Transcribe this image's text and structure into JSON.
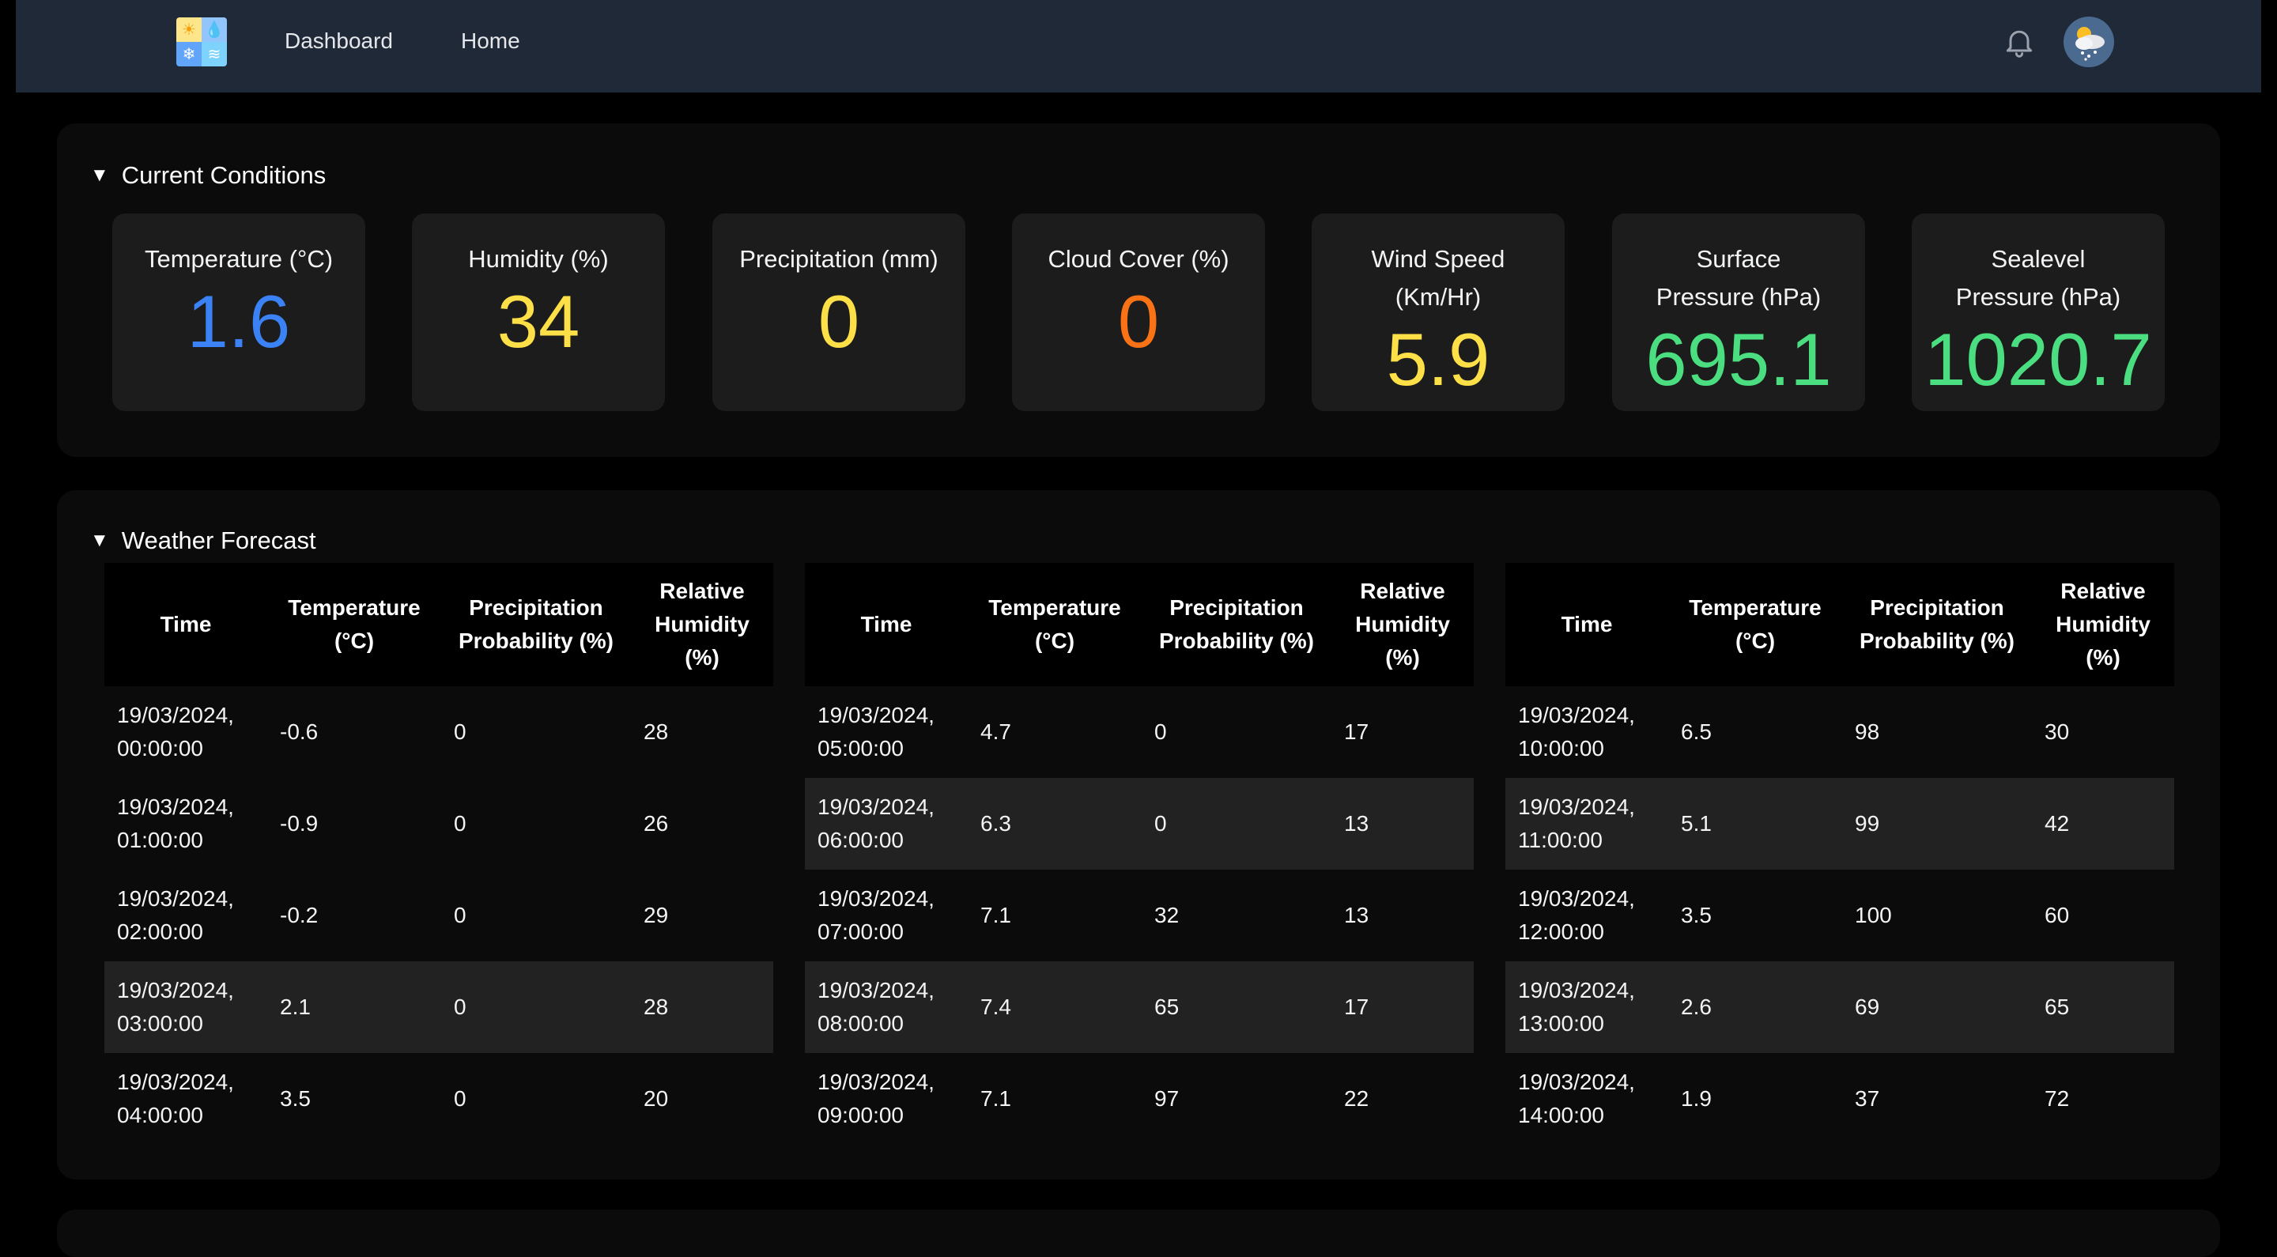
{
  "nav": {
    "links": [
      "Dashboard",
      "Home"
    ]
  },
  "current": {
    "title": "Current Conditions",
    "cards": [
      {
        "label": "Temperature (°C)",
        "value": "1.6",
        "color": "#3b82f6"
      },
      {
        "label": "Humidity (%)",
        "value": "34",
        "color": "#fde047"
      },
      {
        "label": "Precipitation (mm)",
        "value": "0",
        "color": "#fde047"
      },
      {
        "label": "Cloud Cover (%)",
        "value": "0",
        "color": "#f97316"
      },
      {
        "label": "Wind Speed (Km/Hr)",
        "value": "5.9",
        "color": "#fde047"
      },
      {
        "label": "Surface Pressure (hPa)",
        "value": "695.1",
        "color": "#4ade80"
      },
      {
        "label": "Sealevel Pressure (hPa)",
        "value": "1020.7",
        "color": "#4ade80"
      }
    ]
  },
  "forecast": {
    "title": "Weather Forecast",
    "headers": [
      "Time",
      "Temperature (°C)",
      "Precipitation Probability (%)",
      "Relative Humidity (%)"
    ],
    "tables": [
      [
        [
          "19/03/2024, 00:00:00",
          "-0.6",
          "0",
          "28"
        ],
        [
          "19/03/2024, 01:00:00",
          "-0.9",
          "0",
          "26"
        ],
        [
          "19/03/2024, 02:00:00",
          "-0.2",
          "0",
          "29"
        ],
        [
          "19/03/2024, 03:00:00",
          "2.1",
          "0",
          "28"
        ],
        [
          "19/03/2024, 04:00:00",
          "3.5",
          "0",
          "20"
        ]
      ],
      [
        [
          "19/03/2024, 05:00:00",
          "4.7",
          "0",
          "17"
        ],
        [
          "19/03/2024, 06:00:00",
          "6.3",
          "0",
          "13"
        ],
        [
          "19/03/2024, 07:00:00",
          "7.1",
          "32",
          "13"
        ],
        [
          "19/03/2024, 08:00:00",
          "7.4",
          "65",
          "17"
        ],
        [
          "19/03/2024, 09:00:00",
          "7.1",
          "97",
          "22"
        ]
      ],
      [
        [
          "19/03/2024, 10:00:00",
          "6.5",
          "98",
          "30"
        ],
        [
          "19/03/2024, 11:00:00",
          "5.1",
          "99",
          "42"
        ],
        [
          "19/03/2024, 12:00:00",
          "3.5",
          "100",
          "60"
        ],
        [
          "19/03/2024, 13:00:00",
          "2.6",
          "69",
          "65"
        ],
        [
          "19/03/2024, 14:00:00",
          "1.9",
          "37",
          "72"
        ]
      ]
    ]
  }
}
